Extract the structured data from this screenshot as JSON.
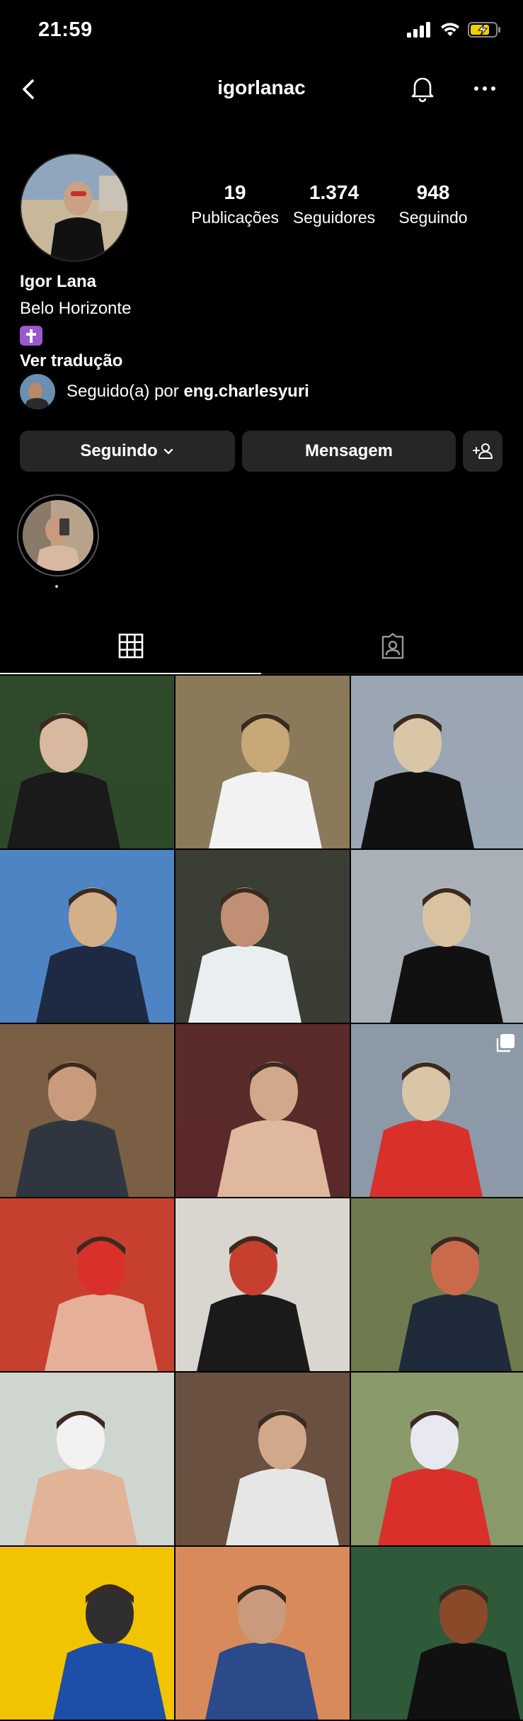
{
  "status_bar": {
    "time": "21:59"
  },
  "header": {
    "username": "igorlanac"
  },
  "profile": {
    "stats": [
      {
        "value": "19",
        "label": "Publicações"
      },
      {
        "value": "1.374",
        "label": "Seguidores"
      },
      {
        "value": "948",
        "label": "Seguindo"
      }
    ],
    "name": "Igor Lana",
    "city": "Belo Horizonte",
    "emoji": "latin-cross-emoji",
    "translate_label": "Ver tradução",
    "followed_by_prefix": "Seguido(a) por ",
    "followed_by_user": "eng.charlesyuri"
  },
  "actions": {
    "following_label": "Seguindo",
    "message_label": "Mensagem"
  },
  "tabs": [
    {
      "icon": "grid-icon",
      "active": true
    },
    {
      "icon": "tagged-icon",
      "active": false
    }
  ],
  "posts": [
    {
      "id": 1,
      "palette": [
        "#2f4a2a",
        "#1a1a1a",
        "#d9b8a0"
      ]
    },
    {
      "id": 2,
      "palette": [
        "#8a7a5a",
        "#f2f2f2",
        "#c9a877"
      ]
    },
    {
      "id": 3,
      "palette": [
        "#9aa6b4",
        "#111111",
        "#d8c6a6"
      ]
    },
    {
      "id": 4,
      "palette": [
        "#4f84c4",
        "#1e2a44",
        "#d4b089"
      ]
    },
    {
      "id": 5,
      "palette": [
        "#3a3e34",
        "#e9eef0",
        "#c08f74"
      ]
    },
    {
      "id": 6,
      "palette": [
        "#a9b0b8",
        "#111111",
        "#d9c2a0"
      ]
    },
    {
      "id": 7,
      "palette": [
        "#7a5f45",
        "#2f3640",
        "#c99b7c"
      ]
    },
    {
      "id": 8,
      "palette": [
        "#5b2a2a",
        "#e0b8a0",
        "#d1a88a"
      ]
    },
    {
      "id": 9,
      "palette": [
        "#8c9aa8",
        "#d9302b",
        "#d8c6a6"
      ],
      "carousel": true
    },
    {
      "id": 10,
      "palette": [
        "#c7402f",
        "#e5b097",
        "#d9302b"
      ]
    },
    {
      "id": 11,
      "palette": [
        "#d9d6d0",
        "#1a1a1a",
        "#c7402f"
      ]
    },
    {
      "id": 12,
      "palette": [
        "#6f7a4f",
        "#1f2a3a",
        "#c96b4a"
      ]
    },
    {
      "id": 13,
      "palette": [
        "#cfd6d0",
        "#e2b396",
        "#f2f2f2"
      ]
    },
    {
      "id": 14,
      "palette": [
        "#6a5040",
        "#e6e6e6",
        "#d1a88a"
      ]
    },
    {
      "id": 15,
      "palette": [
        "#8a9a6a",
        "#d9302b",
        "#e8e8f0"
      ]
    },
    {
      "id": 16,
      "palette": [
        "#f2c300",
        "#1e4fa8",
        "#2f2f2f"
      ]
    },
    {
      "id": 17,
      "palette": [
        "#d98a5a",
        "#2a4a8a",
        "#c99b7c"
      ]
    },
    {
      "id": 18,
      "palette": [
        "#2f5a3a",
        "#111111",
        "#8a4a2a"
      ]
    }
  ]
}
